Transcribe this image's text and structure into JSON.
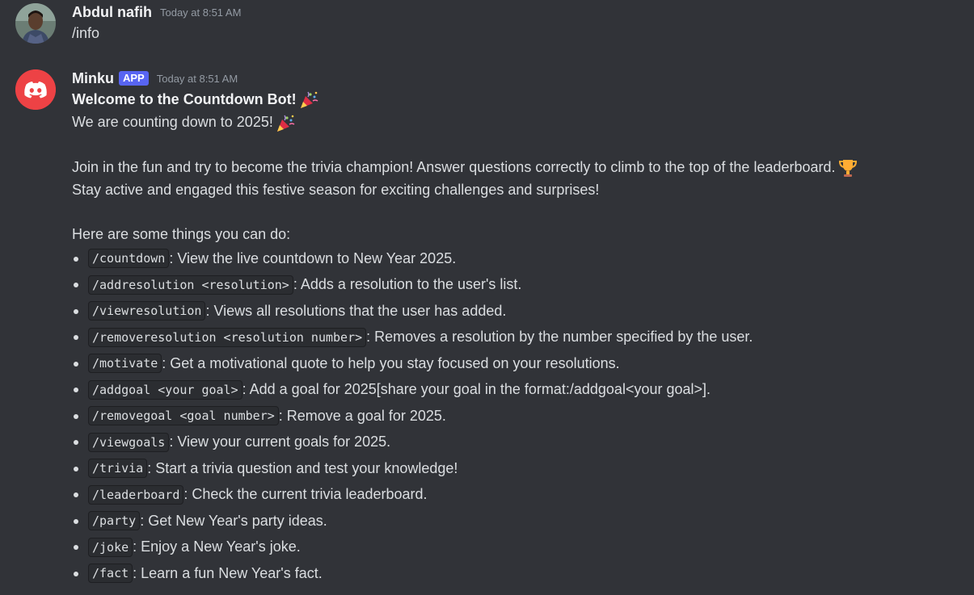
{
  "user_message": {
    "username": "Abdul nafih",
    "timestamp": "Today at 8:51 AM",
    "text": "/info"
  },
  "bot_message": {
    "username": "Minku",
    "badge": "APP",
    "timestamp": "Today at 8:51 AM",
    "title": "Welcome to the Countdown Bot!",
    "line1": "We are counting down to 2025!",
    "para1": "Join in the fun and try to become the trivia champion! Answer questions correctly to climb to the top of the leaderboard.",
    "para2": "Stay active and engaged this festive season for exciting challenges and surprises!",
    "intro": "Here are some things you can do:",
    "commands": [
      {
        "cmd": "/countdown",
        "desc": ": View the live countdown to New Year 2025."
      },
      {
        "cmd": "/addresolution <resolution>",
        "desc": ": Adds a resolution to the user's list."
      },
      {
        "cmd": "/viewresolution",
        "desc": ": Views all resolutions that the user has added."
      },
      {
        "cmd": "/removeresolution <resolution number>",
        "desc": ": Removes a resolution by the number specified by the user."
      },
      {
        "cmd": "/motivate",
        "desc": ": Get a motivational quote to help you stay focused on your resolutions."
      },
      {
        "cmd": "/addgoal <your goal>",
        "desc": ": Add a goal for 2025[share your goal in the format:/addgoal<your goal>]."
      },
      {
        "cmd": "/removegoal <goal number>",
        "desc": ": Remove a goal for 2025."
      },
      {
        "cmd": "/viewgoals",
        "desc": ": View your current goals for 2025."
      },
      {
        "cmd": "/trivia",
        "desc": ": Start a trivia question and test your knowledge!"
      },
      {
        "cmd": "/leaderboard",
        "desc": ": Check the current trivia leaderboard."
      },
      {
        "cmd": "/party",
        "desc": ": Get New Year's party ideas."
      },
      {
        "cmd": "/joke",
        "desc": ": Enjoy a New Year's joke."
      },
      {
        "cmd": "/fact",
        "desc": ": Learn a fun New Year's fact."
      }
    ]
  },
  "icons": {
    "user_avatar": "user-photo-avatar",
    "bot_avatar": "discord-logo-avatar",
    "party_emoji": "party-popper-icon",
    "trophy_emoji": "trophy-icon"
  },
  "colors": {
    "background": "#313338",
    "badge": "#5865f2",
    "bot_avatar": "#ed4245"
  }
}
